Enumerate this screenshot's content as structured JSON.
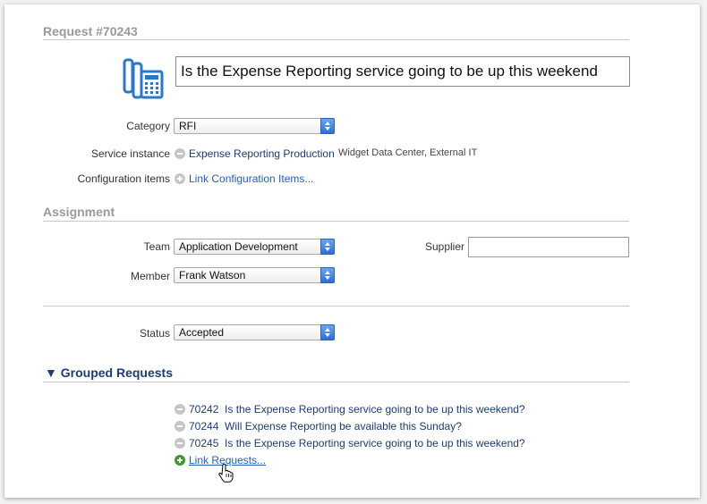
{
  "request": {
    "heading": "Request #70243",
    "title_value": "Is the Expense Reporting service going to be up this weekend",
    "icon": "phone-fax-icon"
  },
  "details": {
    "category_label": "Category",
    "category_value": "RFI",
    "service_label": "Service instance",
    "service_value": "Expense Reporting Production",
    "service_info": "Widget Data Center, External IT",
    "config_label": "Configuration items",
    "config_link": "Link Configuration Items..."
  },
  "assignment": {
    "heading": "Assignment",
    "team_label": "Team",
    "team_value": "Application Development",
    "member_label": "Member",
    "member_value": "Frank Watson",
    "supplier_label": "Supplier",
    "supplier_value": ""
  },
  "status": {
    "label": "Status",
    "value": "Accepted"
  },
  "grouped": {
    "heading": "▼ Grouped Requests",
    "items": [
      {
        "id": "70242",
        "text": "Is the Expense Reporting service going to be up this weekend?"
      },
      {
        "id": "70244",
        "text": "Will Expense Reporting be available this Sunday?"
      },
      {
        "id": "70245",
        "text": "Is the Expense Reporting service going to be up this weekend?"
      }
    ],
    "link_label": "Link Requests..."
  },
  "colors": {
    "accent": "#1c3c78",
    "link": "#1f5fc4",
    "add_green": "#3b9b2e",
    "icon_blue": "#2a78c9"
  }
}
